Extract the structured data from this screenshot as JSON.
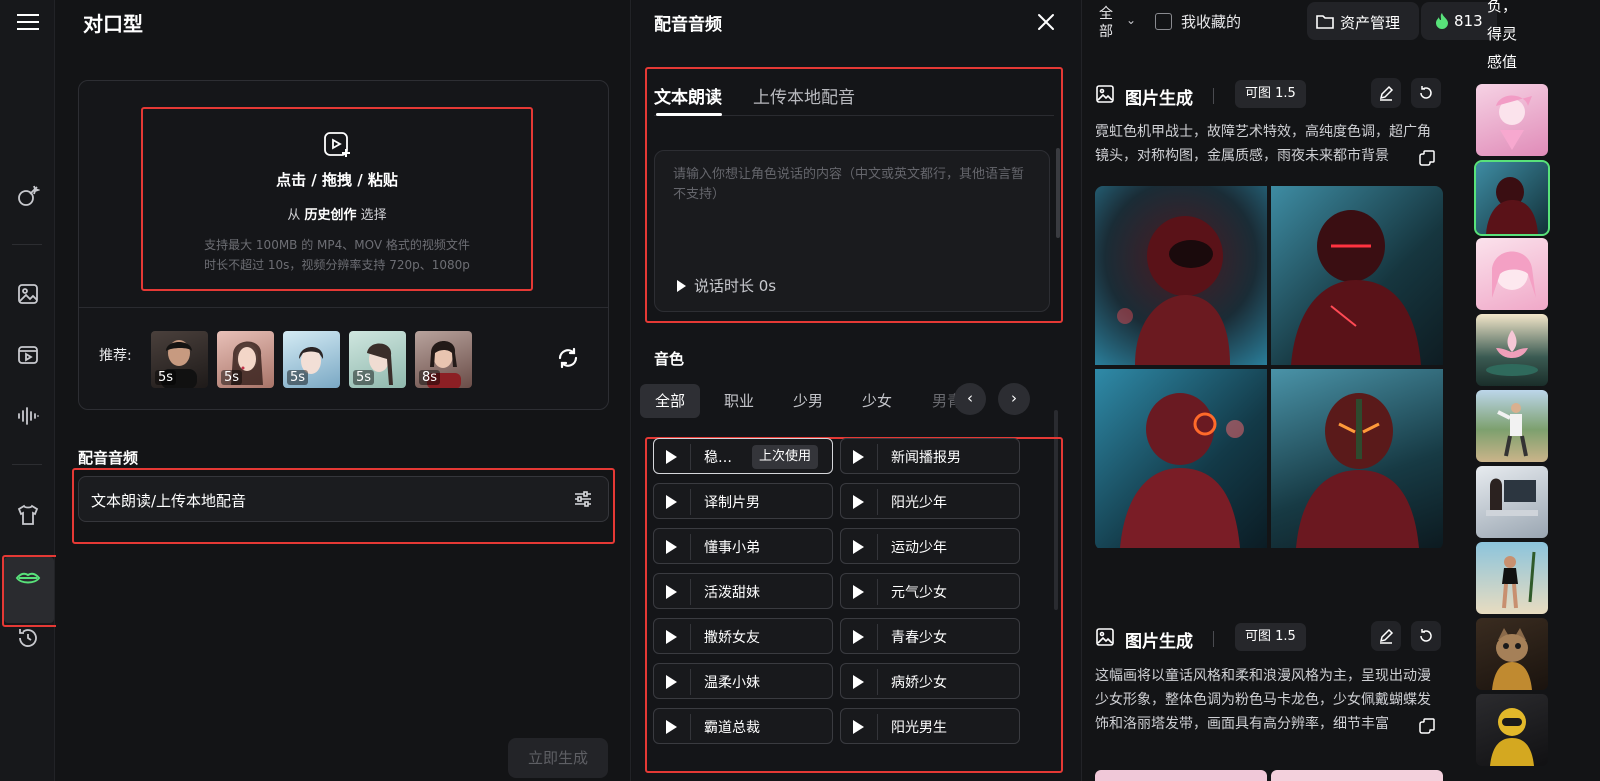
{
  "panel1": {
    "title": "对口型",
    "upload": {
      "main": "点击 / 拖拽 / 粘贴",
      "hist_prefix": "从",
      "hist_link": "历史创作",
      "hist_suffix": "选择",
      "tip_line1": "支持最大 100MB 的 MP4、MOV 格式的视频文件",
      "tip_line2": "时长不超过 10s，视频分辨率支持 720p、1080p"
    },
    "recommend_label": "推荐:",
    "recommend": [
      {
        "duration": "5s",
        "color": "#3a3330"
      },
      {
        "duration": "5s",
        "color": "#c9a49a"
      },
      {
        "duration": "5s",
        "color": "#9fc4d6"
      },
      {
        "duration": "5s",
        "color": "#a9c9c0"
      },
      {
        "duration": "8s",
        "color": "#7a5a55"
      }
    ],
    "audio_section_title": "配音音频",
    "audio_field": "文本朗读/上传本地配音",
    "generate_button": "立即生成"
  },
  "panel2": {
    "title": "配音音频",
    "tabs": [
      "文本朗读",
      "上传本地配音"
    ],
    "textarea_placeholder": "请输入你想让角色说话的内容（中文或英文都行，其他语言暂不支持）",
    "duration_label": "说话时长 0s",
    "timbre_title": "音色",
    "filter_chips": [
      "全部",
      "职业",
      "少男",
      "少女",
      "男青"
    ],
    "voices": [
      {
        "name": "稳…",
        "badge": "上次使用"
      },
      {
        "name": "新闻播报男"
      },
      {
        "name": "译制片男"
      },
      {
        "name": "阳光少年"
      },
      {
        "name": "懂事小弟"
      },
      {
        "name": "运动少年"
      },
      {
        "name": "活泼甜妹"
      },
      {
        "name": "元气少女"
      },
      {
        "name": "撒娇女友"
      },
      {
        "name": "青春少女"
      },
      {
        "name": "温柔小妹"
      },
      {
        "name": "病娇少女"
      },
      {
        "name": "霸道总裁"
      },
      {
        "name": "阳光男生"
      }
    ]
  },
  "panel3": {
    "filter_all": "全部",
    "favorites_label": "我收藏的",
    "asset_button": "资产管理",
    "credits": "813",
    "feedback": "负，得灵感值",
    "generations": [
      {
        "title": "图片生成",
        "model": "可图 1.5",
        "description": "霓虹色机甲战士，故障艺术特效，高纯度色调，超广角镜头，对称构图，金属质感，雨夜未来都市背景"
      },
      {
        "title": "图片生成",
        "model": "可图 1.5",
        "description": "这幅画将以童话风格和柔和浪漫风格为主，呈现出动漫少女形象，整体色调为粉色马卡龙色，少女佩戴蝴蝶发饰和洛丽塔发带，画面具有高分辨率，细节丰富"
      }
    ],
    "thumbnails": [
      "#e7a9c8",
      "#1d4a52",
      "#f2c2d6",
      "#3a5a52",
      "#6f8f7a",
      "#c9cfd6",
      "#7aa3b8",
      "#8a6a3a",
      "#2b2b2e"
    ]
  },
  "colors": {
    "accent_red": "#e53935",
    "accent_green": "#58e27a"
  }
}
